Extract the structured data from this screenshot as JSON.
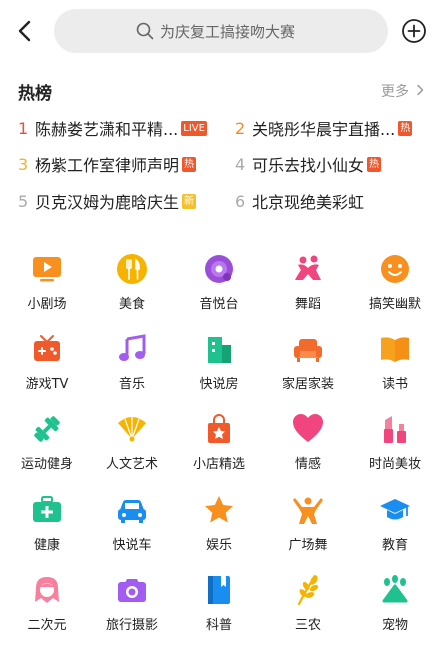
{
  "search": {
    "placeholder": "为庆复工搞接吻大赛"
  },
  "hot": {
    "title": "热榜",
    "more": "更多",
    "items": [
      {
        "rank": "1",
        "text": "陈赫娄艺潇和平精...",
        "badge": "LIVE",
        "rank_color": "#f04a3a",
        "badge_color": "#f0572a"
      },
      {
        "rank": "2",
        "text": "关晓彤华晨宇直播...",
        "badge": "热",
        "rank_color": "#f58a2a",
        "badge_color": "#f0572a"
      },
      {
        "rank": "3",
        "text": "杨紫工作室律师声明",
        "badge": "热",
        "rank_color": "#f5b12a",
        "badge_color": "#f0572a"
      },
      {
        "rank": "4",
        "text": "可乐去找小仙女",
        "badge": "热",
        "rank_color": "#aaaaaa",
        "badge_color": "#f0572a"
      },
      {
        "rank": "5",
        "text": "贝克汉姆为鹿晗庆生",
        "badge": "新",
        "rank_color": "#aaaaaa",
        "badge_color": "#f5c02a"
      },
      {
        "rank": "6",
        "text": "北京现绝美彩虹",
        "badge": "",
        "rank_color": "#aaaaaa",
        "badge_color": ""
      }
    ]
  },
  "categories": [
    {
      "label": "小剧场",
      "icon": "tv-icon"
    },
    {
      "label": "美食",
      "icon": "cutlery-icon"
    },
    {
      "label": "音悦台",
      "icon": "disc-icon"
    },
    {
      "label": "舞蹈",
      "icon": "dance-icon"
    },
    {
      "label": "搞笑幽默",
      "icon": "smile-icon"
    },
    {
      "label": "游戏TV",
      "icon": "gamepad-icon"
    },
    {
      "label": "音乐",
      "icon": "music-note-icon"
    },
    {
      "label": "快说房",
      "icon": "building-icon"
    },
    {
      "label": "家居家装",
      "icon": "sofa-icon"
    },
    {
      "label": "读书",
      "icon": "book-icon"
    },
    {
      "label": "运动健身",
      "icon": "dumbbell-icon"
    },
    {
      "label": "人文艺术",
      "icon": "fan-icon"
    },
    {
      "label": "小店精选",
      "icon": "shopping-bag-icon"
    },
    {
      "label": "情感",
      "icon": "heart-icon"
    },
    {
      "label": "时尚美妆",
      "icon": "lipstick-icon"
    },
    {
      "label": "健康",
      "icon": "medkit-icon"
    },
    {
      "label": "快说车",
      "icon": "car-icon"
    },
    {
      "label": "娱乐",
      "icon": "star-icon"
    },
    {
      "label": "广场舞",
      "icon": "dancer-icon"
    },
    {
      "label": "教育",
      "icon": "graduation-cap-icon"
    },
    {
      "label": "二次元",
      "icon": "anime-icon"
    },
    {
      "label": "旅行摄影",
      "icon": "camera-icon"
    },
    {
      "label": "科普",
      "icon": "science-book-icon"
    },
    {
      "label": "三农",
      "icon": "wheat-icon"
    },
    {
      "label": "宠物",
      "icon": "paw-icon"
    }
  ]
}
